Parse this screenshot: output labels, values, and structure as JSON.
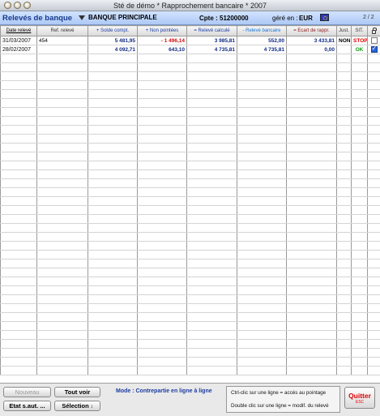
{
  "window": {
    "title": "Sté de démo  *  Rapprochement bancaire  *  2007"
  },
  "header": {
    "title": "Relevés de banque",
    "bank": "BANQUE PRINCIPALE",
    "cpte_label": "Cpte :",
    "cpte_value": "51200000",
    "gere_label": "géré en :",
    "currency": "EUR",
    "page": "2 / 2"
  },
  "columns": [
    "Date relevé",
    "Ref. relevé",
    "+  Solde compt.",
    "+  Non pointées",
    "=  Relevé calculé",
    "-  Relevé bancaire",
    "=  Ecart de rappr.",
    "Just.",
    "SIT.",
    ""
  ],
  "rows": [
    {
      "date": "31/03/2007",
      "ref": "454",
      "solde": "5 481,95",
      "non_pointees": "- 1 496,14",
      "calcule": "3 985,81",
      "bancaire": "552,00",
      "ecart": "3 433,81",
      "just": "NON",
      "sit": "STOP",
      "checked": false
    },
    {
      "date": "28/02/2007",
      "ref": "",
      "solde": "4 092,71",
      "non_pointees": "643,10",
      "calcule": "4 735,81",
      "bancaire": "4 735,81",
      "ecart": "0,00",
      "just": "",
      "sit": "OK",
      "checked": true
    }
  ],
  "footer": {
    "nouveau": "Nouveau",
    "tout_voir": "Tout voir",
    "etat": "Etat s.aut. ...",
    "selection": "Sélection",
    "mode": "Mode : Contrepartie en ligne à ligne",
    "hint1": "Ctrl-clic  sur une ligne = accès au pointage",
    "hint2": "Double clic sur une ligne = modif. du relevé",
    "quitter": "Quitter",
    "quitter_shortcut": "ESC"
  },
  "colors": {
    "header_band": "#b9d1f7",
    "title_blue": "#173a8e",
    "stop_red": "#e00000",
    "ok_green": "#139d13"
  }
}
